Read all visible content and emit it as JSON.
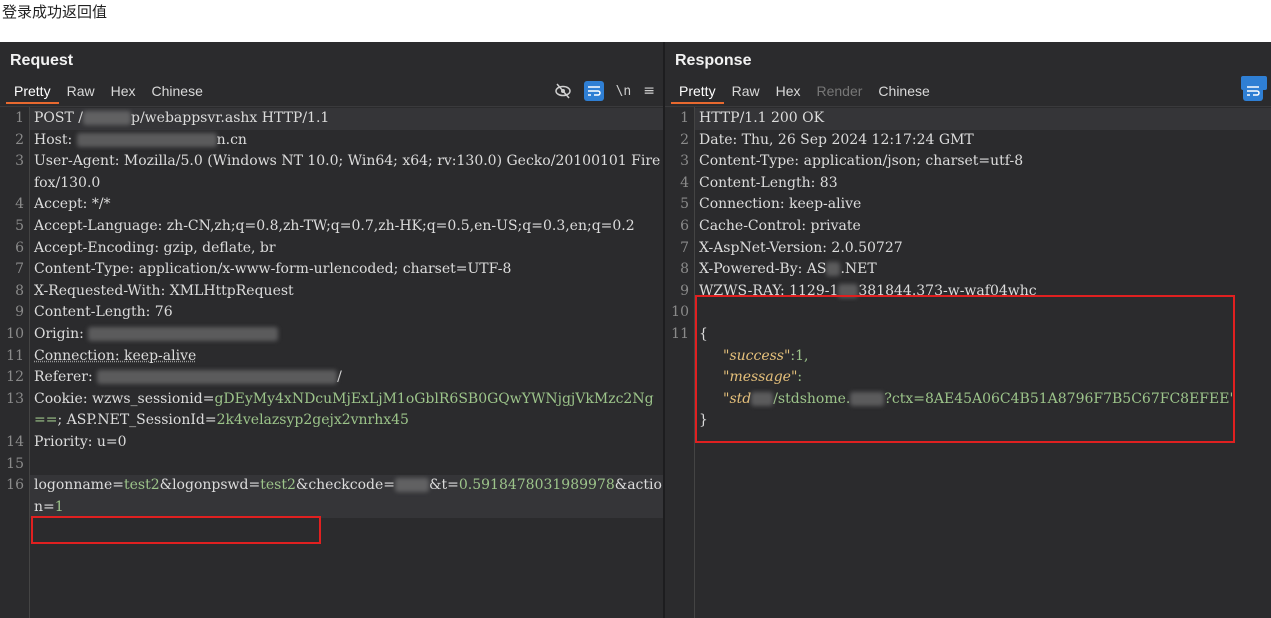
{
  "caption": "登录成功返回值",
  "request": {
    "title": "Request",
    "tabs": [
      "Pretty",
      "Raw",
      "Hex",
      "Chinese"
    ],
    "tools": {
      "newline": "\\n",
      "menu": "≡"
    },
    "lines": {
      "l1": "POST /",
      "l1b": "p/webappsvr.ashx HTTP/1.1",
      "l2": "Host: ",
      "l2b": "n.cn",
      "l3": "User-Agent: Mozilla/5.0 (Windows NT 10.0; Win64; x64; rv:130.0) Gecko/20100101 Firefox/130.0",
      "l4": "Accept: */*",
      "l5": "Accept-Language: zh-CN,zh;q=0.8,zh-TW;q=0.7,zh-HK;q=0.5,en-US;q=0.3,en;q=0.2",
      "l6": "Accept-Encoding: gzip, deflate, br",
      "l7": "Content-Type: application/x-www-form-urlencoded; charset=UTF-8",
      "l8": "X-Requested-With: XMLHttpRequest",
      "l9": "Content-Length: 76",
      "l10": "Origin: ",
      "l11": "Connection: keep-alive",
      "l12": "Referer: ",
      "l12b": "/",
      "l13k": "Cookie: wzws_sessionid=",
      "l13v": "gDEyMy4xNDcuMjExLjM1oGblR6SB0GQwYWNjgjVkMzc2Ng==",
      "l13m": "; ASP.NET_SessionId=",
      "l13v2": "2k4velazsyp2gejx2vnrhx45",
      "l14": "Priority: u=0",
      "l15": "",
      "b1": "logonname=",
      "b2": "test2",
      "b3": "&logonpswd=",
      "b4": "test2",
      "b5": "&checkcode=",
      "b6": "&t=",
      "b7": "0.5918478031989978",
      "b8": "&action=",
      "b9": "1"
    }
  },
  "response": {
    "title": "Response",
    "tabs": [
      "Pretty",
      "Raw",
      "Hex",
      "Render",
      "Chinese"
    ],
    "lines": {
      "l1": "HTTP/1.1 200 OK",
      "l2": "Date: Thu, 26 Sep 2024 12:17:24 GMT",
      "l3": "Content-Type: application/json; charset=utf-8",
      "l4": "Content-Length: 83",
      "l5": "Connection: keep-alive",
      "l6": "Cache-Control: private",
      "l7": "X-AspNet-Version: 2.0.50727",
      "l8a": "X-Powered-By: AS",
      "l8b": ".NET",
      "l9a": "WZWS-RAY: 1129-1",
      "l9b": "381844.373-w-waf04whc",
      "l10": "",
      "l11": "{",
      "k1": "\"success\"",
      "v1": ":1,",
      "k2": "\"message\"",
      "v2": ":",
      "m1": "\"std",
      "m2": "/stdshome.",
      "m3": "?ctx=8AE45A06C4B51A8796F7B5C67FC8EFEE\"",
      "close": "}"
    }
  }
}
